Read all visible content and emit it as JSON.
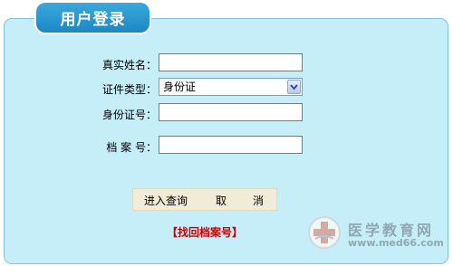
{
  "panel": {
    "title": "用户登录"
  },
  "form": {
    "name_label": "真实姓名：",
    "name_value": "",
    "doc_type_label": "证件类型：",
    "doc_type_selected": "身份证",
    "id_label": "身份证号：",
    "id_value": "",
    "archive_label": "档 案 号：",
    "archive_value": ""
  },
  "buttons": {
    "submit": "进入查询",
    "cancel_left": "取",
    "cancel_right": "消"
  },
  "links": {
    "recover": "【找回档案号】"
  },
  "watermark": {
    "name": "医学教育网",
    "url": "www.med66.com"
  }
}
